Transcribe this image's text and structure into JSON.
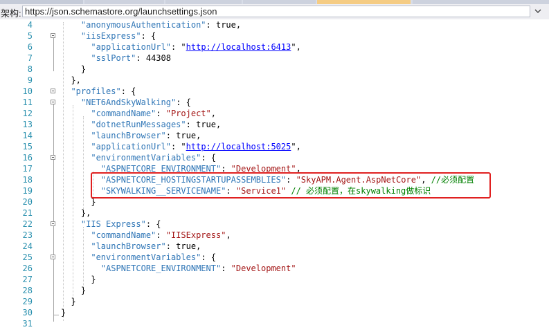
{
  "toolbar": {
    "schema_label": "架构:",
    "schema_url": "https://json.schemastore.org/launchsettings.json"
  },
  "editor": {
    "lines": [
      {
        "n": "4",
        "parts": [
          [
            "p",
            "    "
          ],
          [
            "k",
            "\"anonymousAuthentication\""
          ],
          [
            "p",
            ": true,"
          ]
        ]
      },
      {
        "n": "5",
        "parts": [
          [
            "p",
            "    "
          ],
          [
            "k",
            "\"iisExpress\""
          ],
          [
            "p",
            ": {"
          ]
        ]
      },
      {
        "n": "6",
        "parts": [
          [
            "p",
            "      "
          ],
          [
            "k",
            "\"applicationUrl\""
          ],
          [
            "p",
            ": \""
          ],
          [
            "u",
            "http://localhost:6413"
          ],
          [
            "p",
            "\","
          ]
        ]
      },
      {
        "n": "7",
        "parts": [
          [
            "p",
            "      "
          ],
          [
            "k",
            "\"sslPort\""
          ],
          [
            "p",
            ": 44308"
          ]
        ]
      },
      {
        "n": "8",
        "parts": [
          [
            "p",
            "    }"
          ]
        ]
      },
      {
        "n": "9",
        "parts": [
          [
            "p",
            "  },"
          ]
        ]
      },
      {
        "n": "10",
        "parts": [
          [
            "p",
            "  "
          ],
          [
            "k",
            "\"profiles\""
          ],
          [
            "p",
            ": {"
          ]
        ]
      },
      {
        "n": "11",
        "parts": [
          [
            "p",
            "    "
          ],
          [
            "k",
            "\"NET6AndSkyWalking\""
          ],
          [
            "p",
            ": {"
          ]
        ]
      },
      {
        "n": "12",
        "parts": [
          [
            "p",
            "      "
          ],
          [
            "k",
            "\"commandName\""
          ],
          [
            "p",
            ": "
          ],
          [
            "s",
            "\"Project\""
          ],
          [
            "p",
            ","
          ]
        ]
      },
      {
        "n": "13",
        "parts": [
          [
            "p",
            "      "
          ],
          [
            "k",
            "\"dotnetRunMessages\""
          ],
          [
            "p",
            ": true,"
          ]
        ]
      },
      {
        "n": "14",
        "parts": [
          [
            "p",
            "      "
          ],
          [
            "k",
            "\"launchBrowser\""
          ],
          [
            "p",
            ": true,"
          ]
        ]
      },
      {
        "n": "15",
        "parts": [
          [
            "p",
            "      "
          ],
          [
            "k",
            "\"applicationUrl\""
          ],
          [
            "p",
            ": \""
          ],
          [
            "u",
            "http://localhost:5025"
          ],
          [
            "p",
            "\","
          ]
        ]
      },
      {
        "n": "16",
        "parts": [
          [
            "p",
            "      "
          ],
          [
            "k",
            "\"environmentVariables\""
          ],
          [
            "p",
            ": {"
          ]
        ]
      },
      {
        "n": "17",
        "parts": [
          [
            "p",
            "        "
          ],
          [
            "k",
            "\"ASPNETCORE_ENVIRONMENT\""
          ],
          [
            "p",
            ": "
          ],
          [
            "s",
            "\"Development\""
          ],
          [
            "p",
            ","
          ]
        ]
      },
      {
        "n": "18",
        "parts": [
          [
            "p",
            "        "
          ],
          [
            "k",
            "\"ASPNETCORE_HOSTINGSTARTUPASSEMBLIES\""
          ],
          [
            "p",
            ": "
          ],
          [
            "s",
            "\"SkyAPM.Agent.AspNetCore\""
          ],
          [
            "p",
            ", "
          ],
          [
            "c",
            "//必须配置"
          ]
        ]
      },
      {
        "n": "19",
        "parts": [
          [
            "p",
            "        "
          ],
          [
            "k",
            "\"SKYWALKING__SERVICENAME\""
          ],
          [
            "p",
            ": "
          ],
          [
            "s",
            "\"Service1\""
          ],
          [
            "p",
            " "
          ],
          [
            "c",
            "// 必须配置，在skywalking做标识"
          ]
        ]
      },
      {
        "n": "20",
        "parts": [
          [
            "p",
            "      }"
          ]
        ]
      },
      {
        "n": "21",
        "parts": [
          [
            "p",
            "    },"
          ]
        ]
      },
      {
        "n": "22",
        "parts": [
          [
            "p",
            "    "
          ],
          [
            "k",
            "\"IIS Express\""
          ],
          [
            "p",
            ": {"
          ]
        ]
      },
      {
        "n": "23",
        "parts": [
          [
            "p",
            "      "
          ],
          [
            "k",
            "\"commandName\""
          ],
          [
            "p",
            ": "
          ],
          [
            "s",
            "\"IISExpress\""
          ],
          [
            "p",
            ","
          ]
        ]
      },
      {
        "n": "24",
        "parts": [
          [
            "p",
            "      "
          ],
          [
            "k",
            "\"launchBrowser\""
          ],
          [
            "p",
            ": true,"
          ]
        ]
      },
      {
        "n": "25",
        "parts": [
          [
            "p",
            "      "
          ],
          [
            "k",
            "\"environmentVariables\""
          ],
          [
            "p",
            ": {"
          ]
        ]
      },
      {
        "n": "26",
        "parts": [
          [
            "p",
            "        "
          ],
          [
            "k",
            "\"ASPNETCORE_ENVIRONMENT\""
          ],
          [
            "p",
            ": "
          ],
          [
            "s",
            "\"Development\""
          ]
        ]
      },
      {
        "n": "27",
        "parts": [
          [
            "p",
            "      }"
          ]
        ]
      },
      {
        "n": "28",
        "parts": [
          [
            "p",
            "    }"
          ]
        ]
      },
      {
        "n": "29",
        "parts": [
          [
            "p",
            "  }"
          ]
        ]
      },
      {
        "n": "30",
        "parts": [
          [
            "p",
            "}"
          ]
        ]
      },
      {
        "n": "31",
        "parts": []
      }
    ]
  }
}
